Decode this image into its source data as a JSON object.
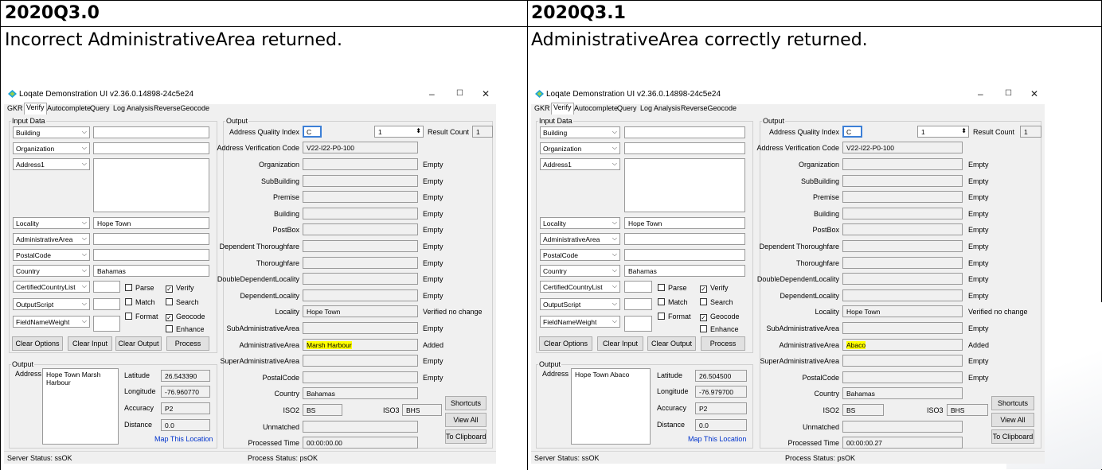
{
  "left": {
    "version": "2020Q3.0",
    "description": "Incorrect AdministrativeArea returned.",
    "window": {
      "title": "Loqate Demonstration UI v2.36.0.14898-24c5e24",
      "tabs": [
        "GKR",
        "Verify",
        "Autocomplete",
        "Query",
        "Log Analysis",
        "ReverseGeocode"
      ],
      "input_group": "Input Data",
      "output_group": "Output",
      "inputs": [
        {
          "label": "Building",
          "value": ""
        },
        {
          "label": "Organization",
          "value": ""
        },
        {
          "label": "Address1",
          "value": ""
        },
        {
          "label": "Locality",
          "value": "Hope Town"
        },
        {
          "label": "AdministrativeArea",
          "value": ""
        },
        {
          "label": "PostalCode",
          "value": ""
        },
        {
          "label": "Country",
          "value": "Bahamas"
        }
      ],
      "options": [
        "CertifiedCountryList",
        "OutputScript",
        "FieldNameWeight"
      ],
      "checks": [
        {
          "label": "Parse",
          "checked": false
        },
        {
          "label": "Verify",
          "checked": true
        },
        {
          "label": "Match",
          "checked": false
        },
        {
          "label": "Search",
          "checked": false
        },
        {
          "label": "Format",
          "checked": false
        },
        {
          "label": "Geocode",
          "checked": true
        },
        {
          "label": "Enhance",
          "checked": false
        }
      ],
      "buttons": [
        "Clear Options",
        "Clear Input",
        "Clear Output",
        "Process"
      ],
      "out_group": "Output",
      "out_address_label": "Address",
      "out_address": "Hope Town Marsh Harbour",
      "latitude_label": "Latitude",
      "latitude": "26.543390",
      "longitude_label": "Longitude",
      "longitude": "-76.960770",
      "accuracy_label": "Accuracy",
      "accuracy": "P2",
      "distance_label": "Distance",
      "distance": "0.0",
      "map_link": "Map This Location",
      "aqi_label": "Address Quality Index",
      "aqi": "C",
      "result_num": "1",
      "result_count_label": "Result Count",
      "result_count": "1",
      "avc_label": "Address Verification Code",
      "avc": "V22-I22-P0-100",
      "fields": [
        {
          "label": "Organization",
          "value": "",
          "status": "Empty"
        },
        {
          "label": "SubBuilding",
          "value": "",
          "status": "Empty"
        },
        {
          "label": "Premise",
          "value": "",
          "status": "Empty"
        },
        {
          "label": "Building",
          "value": "",
          "status": "Empty"
        },
        {
          "label": "PostBox",
          "value": "",
          "status": "Empty"
        },
        {
          "label": "Dependent Thoroughfare",
          "value": "",
          "status": "Empty"
        },
        {
          "label": "Thoroughfare",
          "value": "",
          "status": "Empty"
        },
        {
          "label": "DoubleDependentLocality",
          "value": "",
          "status": "Empty"
        },
        {
          "label": "DependentLocality",
          "value": "",
          "status": "Empty"
        },
        {
          "label": "Locality",
          "value": "Hope Town",
          "status": "Verified no change"
        },
        {
          "label": "SubAdministrativeArea",
          "value": "",
          "status": "Empty"
        },
        {
          "label": "AdministrativeArea",
          "value": "Marsh Harbour",
          "status": "Added",
          "highlight": true
        },
        {
          "label": "SuperAdministrativeArea",
          "value": "",
          "status": "Empty"
        },
        {
          "label": "PostalCode",
          "value": "",
          "status": "Empty"
        },
        {
          "label": "Country",
          "value": "Bahamas",
          "status": ""
        }
      ],
      "iso2_label": "ISO2",
      "iso2": "BS",
      "iso3_label": "ISO3",
      "iso3": "BHS",
      "unmatched_label": "Unmatched",
      "processed_label": "Processed Time",
      "processed": "00:00:00.00",
      "side_buttons": [
        "Shortcuts",
        "View All",
        "To Clipboard"
      ],
      "server_status": "Server Status: ssOK",
      "process_status": "Process Status: psOK"
    }
  },
  "right": {
    "version": "2020Q3.1",
    "description": "AdministrativeArea correctly returned.",
    "window": {
      "title": "Loqate Demonstration UI v2.36.0.14898-24c5e24",
      "tabs": [
        "GKR",
        "Verify",
        "Autocomplete",
        "Query",
        "Log Analysis",
        "ReverseGeocode"
      ],
      "input_group": "Input Data",
      "output_group": "Output",
      "inputs": [
        {
          "label": "Building",
          "value": ""
        },
        {
          "label": "Organization",
          "value": ""
        },
        {
          "label": "Address1",
          "value": ""
        },
        {
          "label": "Locality",
          "value": "Hope Town"
        },
        {
          "label": "AdministrativeArea",
          "value": ""
        },
        {
          "label": "PostalCode",
          "value": ""
        },
        {
          "label": "Country",
          "value": "Bahamas"
        }
      ],
      "options": [
        "CertifiedCountryList",
        "OutputScript",
        "FieldNameWeight"
      ],
      "checks": [
        {
          "label": "Parse",
          "checked": false
        },
        {
          "label": "Verify",
          "checked": true
        },
        {
          "label": "Match",
          "checked": false
        },
        {
          "label": "Search",
          "checked": false
        },
        {
          "label": "Format",
          "checked": false
        },
        {
          "label": "Geocode",
          "checked": true
        },
        {
          "label": "Enhance",
          "checked": false
        }
      ],
      "buttons": [
        "Clear Options",
        "Clear Input",
        "Clear Output",
        "Process"
      ],
      "out_group": "Output",
      "out_address_label": "Address",
      "out_address": "Hope Town Abaco",
      "latitude_label": "Latitude",
      "latitude": "26.504500",
      "longitude_label": "Longitude",
      "longitude": "-76.979700",
      "accuracy_label": "Accuracy",
      "accuracy": "P2",
      "distance_label": "Distance",
      "distance": "0.0",
      "map_link": "Map This Location",
      "aqi_label": "Address Quality Index",
      "aqi": "C",
      "result_num": "1",
      "result_count_label": "Result Count",
      "result_count": "1",
      "avc_label": "Address Verification Code",
      "avc": "V22-I22-P0-100",
      "fields": [
        {
          "label": "Organization",
          "value": "",
          "status": "Empty"
        },
        {
          "label": "SubBuilding",
          "value": "",
          "status": "Empty"
        },
        {
          "label": "Premise",
          "value": "",
          "status": "Empty"
        },
        {
          "label": "Building",
          "value": "",
          "status": "Empty"
        },
        {
          "label": "PostBox",
          "value": "",
          "status": "Empty"
        },
        {
          "label": "Dependent Thoroughfare",
          "value": "",
          "status": "Empty"
        },
        {
          "label": "Thoroughfare",
          "value": "",
          "status": "Empty"
        },
        {
          "label": "DoubleDependentLocality",
          "value": "",
          "status": "Empty"
        },
        {
          "label": "DependentLocality",
          "value": "",
          "status": "Empty"
        },
        {
          "label": "Locality",
          "value": "Hope Town",
          "status": "Verified no change"
        },
        {
          "label": "SubAdministrativeArea",
          "value": "",
          "status": "Empty"
        },
        {
          "label": "AdministrativeArea",
          "value": "Abaco",
          "status": "Added",
          "highlight": true
        },
        {
          "label": "SuperAdministrativeArea",
          "value": "",
          "status": "Empty"
        },
        {
          "label": "PostalCode",
          "value": "",
          "status": "Empty"
        },
        {
          "label": "Country",
          "value": "Bahamas",
          "status": ""
        }
      ],
      "iso2_label": "ISO2",
      "iso2": "BS",
      "iso3_label": "ISO3",
      "iso3": "BHS",
      "unmatched_label": "Unmatched",
      "processed_label": "Processed Time",
      "processed": "00:00:00.27",
      "side_buttons": [
        "Shortcuts",
        "View All",
        "To Clipboard"
      ],
      "server_status": "Server Status: ssOK",
      "process_status": "Process Status: psOK"
    }
  }
}
